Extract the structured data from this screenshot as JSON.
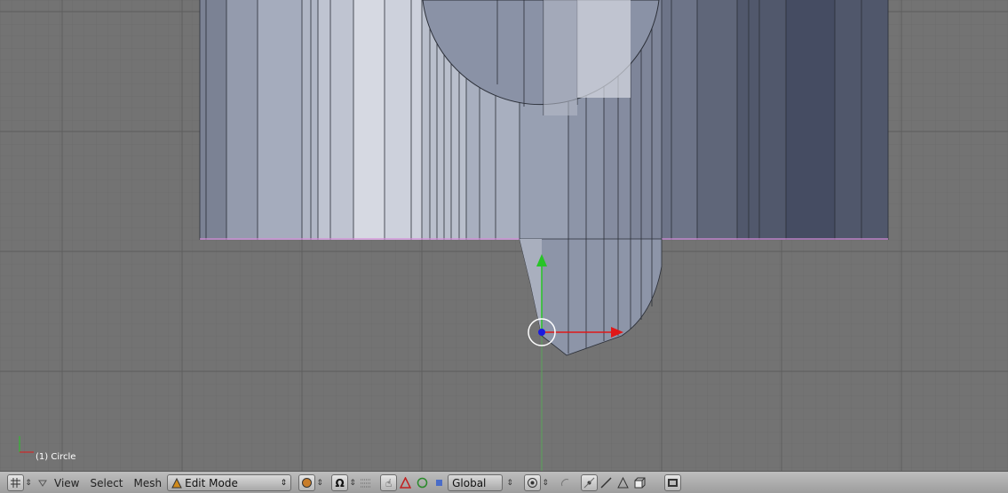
{
  "viewport": {
    "object_label": "(1) Circle",
    "background": "#737373",
    "mesh_color": "#9fa6b6"
  },
  "header": {
    "menus": {
      "view": "View",
      "select": "Select",
      "mesh": "Mesh"
    },
    "mode": "Edit Mode",
    "orientation": "Global",
    "icons": [
      "grid-icon",
      "triangle-down-icon",
      "shading-icon",
      "pivot-icon",
      "manipulator-hand-icon",
      "translate-icon",
      "rotate-icon",
      "scale-icon",
      "proportional-icon",
      "snap-icon",
      "vertex-select-icon",
      "edge-select-icon",
      "face-select-icon",
      "occlude-icon",
      "render-icon"
    ]
  }
}
